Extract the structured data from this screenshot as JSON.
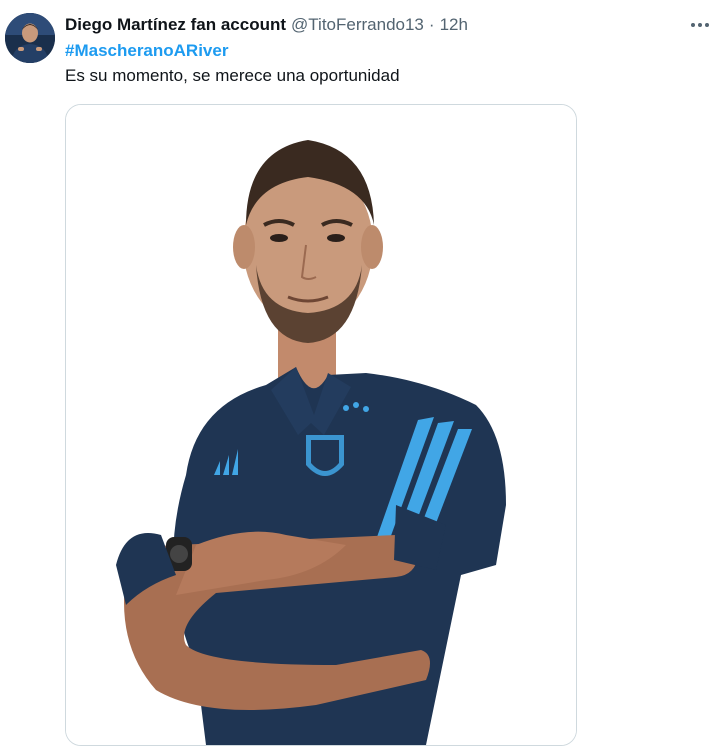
{
  "tweet": {
    "display_name": "Diego Martínez fan account",
    "handle": "@TitoFerrando13",
    "separator": "·",
    "time": "12h",
    "more_icon": "more-horizontal-icon",
    "hashtag": "#MascheranoARiver",
    "text": "Es su momento, se merece una oportunidad"
  },
  "colors": {
    "name": "#0f1419",
    "secondary": "#536471",
    "link": "#1d9bf0",
    "border": "#cfd9de",
    "jersey_navy": "#1f3553",
    "jersey_stripe": "#41a6e6"
  }
}
